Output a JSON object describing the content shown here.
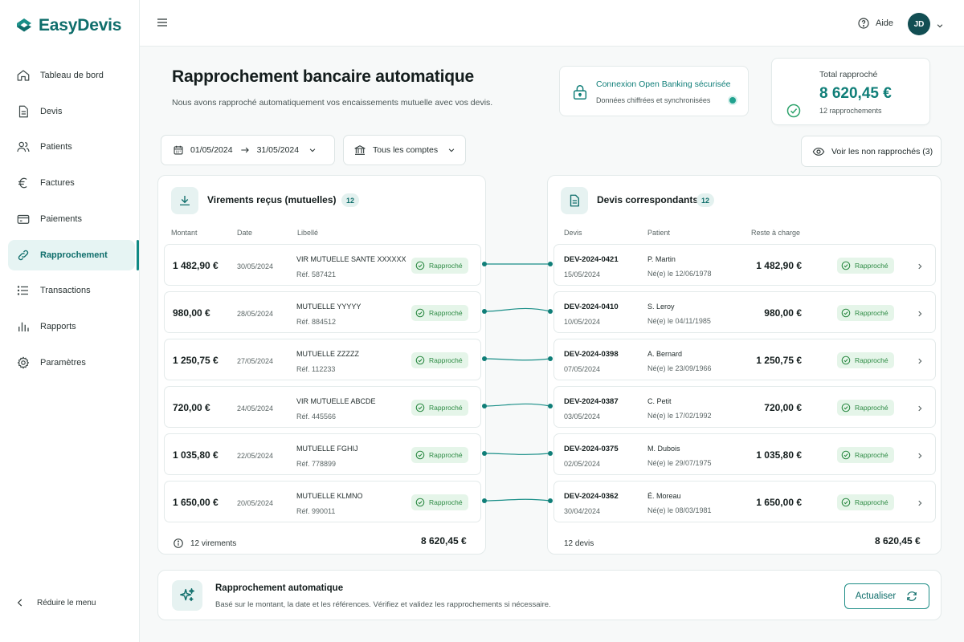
{
  "app": {
    "brand": "EasyDevis"
  },
  "sidebar": {
    "items": [
      {
        "label": "Tableau de bord"
      },
      {
        "label": "Devis"
      },
      {
        "label": "Patients"
      },
      {
        "label": "Factures"
      },
      {
        "label": "Paiements"
      },
      {
        "label": "Rapprochement"
      },
      {
        "label": "Transactions"
      },
      {
        "label": "Rapports"
      },
      {
        "label": "Paramètres"
      }
    ],
    "collapse_label": "Réduire le menu"
  },
  "topbar": {
    "help_label": "Aide",
    "user_initials": "JD"
  },
  "header": {
    "title": "Rapprochement bancaire automatique",
    "subtitle": "Nous avons rapproché automatiquement vos encaissements mutuelle avec vos devis."
  },
  "secure": {
    "title": "Connexion Open Banking sécurisée",
    "subtitle": "Données chiffrées et synchronisées"
  },
  "total": {
    "label": "Total rapproché",
    "value": "8 620,45 €",
    "count": "12 rapprochements"
  },
  "filters": {
    "date_from": "01/05/2024",
    "date_to": "31/05/2024",
    "account": "Tous les comptes",
    "show_unmatched": "Voir les non rapprochés (3)"
  },
  "transfers": {
    "title": "Virements reçus (mutuelles)",
    "count": "12",
    "headers": {
      "amount": "Montant",
      "date": "Date",
      "label": "Libellé"
    },
    "rows": [
      {
        "amount": "1 482,90 €",
        "date": "30/05/2024",
        "label": "VIR MUTUELLE SANTE XXXXXX",
        "ref": "Réf. 587421",
        "status": "Rapproché"
      },
      {
        "amount": "980,00 €",
        "date": "28/05/2024",
        "label": "MUTUELLE YYYYY",
        "ref": "Réf. 884512",
        "status": "Rapproché"
      },
      {
        "amount": "1 250,75 €",
        "date": "27/05/2024",
        "label": "MUTUELLE ZZZZZ",
        "ref": "Réf. 112233",
        "status": "Rapproché"
      },
      {
        "amount": "720,00 €",
        "date": "24/05/2024",
        "label": "VIR MUTUELLE ABCDE",
        "ref": "Réf. 445566",
        "status": "Rapproché"
      },
      {
        "amount": "1 035,80 €",
        "date": "22/05/2024",
        "label": "MUTUELLE FGHIJ",
        "ref": "Réf. 778899",
        "status": "Rapproché"
      },
      {
        "amount": "1 650,00 €",
        "date": "20/05/2024",
        "label": "MUTUELLE KLMNO",
        "ref": "Réf. 990011",
        "status": "Rapproché"
      }
    ],
    "footer_count": "12 virements",
    "footer_total": "8 620,45 €"
  },
  "quotes": {
    "title": "Devis correspondants",
    "count": "12",
    "headers": {
      "quote": "Devis",
      "patient": "Patient",
      "remaining": "Reste à charge"
    },
    "rows": [
      {
        "id": "DEV-2024-0421",
        "date": "15/05/2024",
        "patient": "P. Martin",
        "birth": "Né(e) le 12/06/1978",
        "amount": "1 482,90 €",
        "status": "Rapproché"
      },
      {
        "id": "DEV-2024-0410",
        "date": "10/05/2024",
        "patient": "S. Leroy",
        "birth": "Né(e) le 04/11/1985",
        "amount": "980,00 €",
        "status": "Rapproché"
      },
      {
        "id": "DEV-2024-0398",
        "date": "07/05/2024",
        "patient": "A. Bernard",
        "birth": "Né(e) le 23/09/1966",
        "amount": "1 250,75 €",
        "status": "Rapproché"
      },
      {
        "id": "DEV-2024-0387",
        "date": "03/05/2024",
        "patient": "C. Petit",
        "birth": "Né(e) le 17/02/1992",
        "amount": "720,00 €",
        "status": "Rapproché"
      },
      {
        "id": "DEV-2024-0375",
        "date": "02/05/2024",
        "patient": "M. Dubois",
        "birth": "Né(e) le 29/07/1975",
        "amount": "1 035,80 €",
        "status": "Rapproché"
      },
      {
        "id": "DEV-2024-0362",
        "date": "30/04/2024",
        "patient": "É. Moreau",
        "birth": "Né(e) le 08/03/1981",
        "amount": "1 650,00 €",
        "status": "Rapproché"
      }
    ],
    "footer_count": "12 devis",
    "footer_total": "8 620,45 €"
  },
  "auto": {
    "title": "Rapprochement automatique",
    "subtitle": "Basé sur le montant, la date et les références. Vérifiez et validez les rapprochements si nécessaire.",
    "button": "Actualiser"
  },
  "colors": {
    "accent": "#0f6e6b",
    "success": "#2c8a43",
    "success_bg": "#e5f5e9"
  }
}
